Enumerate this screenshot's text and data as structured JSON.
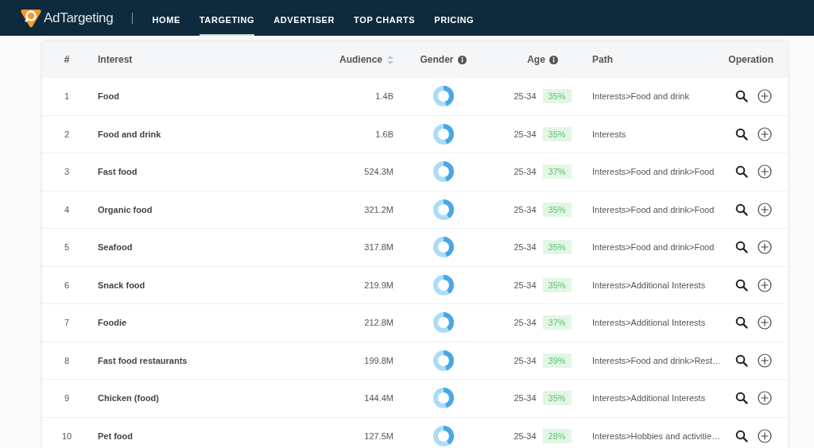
{
  "nav": {
    "brand": "AdTargeting",
    "links": [
      {
        "label": "HOME",
        "selected": false
      },
      {
        "label": "TARGETING",
        "selected": true
      },
      {
        "label": "ADVERTISER",
        "selected": false
      },
      {
        "label": "TOP CHARTS",
        "selected": false
      },
      {
        "label": "PRICING",
        "selected": false
      }
    ]
  },
  "table": {
    "columns": [
      "#",
      "Interest",
      "Audience",
      "Gender",
      "Age",
      "Path",
      "Operation"
    ],
    "rows": [
      {
        "index": "1",
        "interest": "Food",
        "audience": "1.4B",
        "level": 0.45,
        "age": "25-34",
        "age_share": "35%",
        "path": "Interests>Food and drink"
      },
      {
        "index": "2",
        "interest": "Food and drink",
        "audience": "1.6B",
        "level": 0.45,
        "age": "25-34",
        "age_share": "35%",
        "path": "Interests"
      },
      {
        "index": "3",
        "interest": "Fast food",
        "audience": "524.3M",
        "level": 0.45,
        "age": "25-34",
        "age_share": "37%",
        "path": "Interests>Food and drink>Food"
      },
      {
        "index": "4",
        "interest": "Organic food",
        "audience": "321.2M",
        "level": 0.4,
        "age": "25-34",
        "age_share": "35%",
        "path": "Interests>Food and drink>Food"
      },
      {
        "index": "5",
        "interest": "Seafood",
        "audience": "317.8M",
        "level": 0.45,
        "age": "25-34",
        "age_share": "35%",
        "path": "Interests>Food and drink>Food"
      },
      {
        "index": "6",
        "interest": "Snack food",
        "audience": "219.9M",
        "level": 0.4,
        "age": "25-34",
        "age_share": "35%",
        "path": "Interests>Additional Interests"
      },
      {
        "index": "7",
        "interest": "Foodie",
        "audience": "212.8M",
        "level": 0.4,
        "age": "25-34",
        "age_share": "37%",
        "path": "Interests>Additional Interests"
      },
      {
        "index": "8",
        "interest": "Fast food restaurants",
        "audience": "199.8M",
        "level": 0.45,
        "age": "25-34",
        "age_share": "39%",
        "path": "Interests>Food and drink>Rest…"
      },
      {
        "index": "9",
        "interest": "Chicken (food)",
        "audience": "144.4M",
        "level": 0.45,
        "age": "25-34",
        "age_share": "35%",
        "path": "Interests>Additional Interests"
      },
      {
        "index": "10",
        "interest": "Pet food",
        "audience": "127.5M",
        "level": 0.4,
        "age": "25-34",
        "age_share": "28%",
        "path": "Interests>Hobbies and activitie…"
      }
    ]
  }
}
